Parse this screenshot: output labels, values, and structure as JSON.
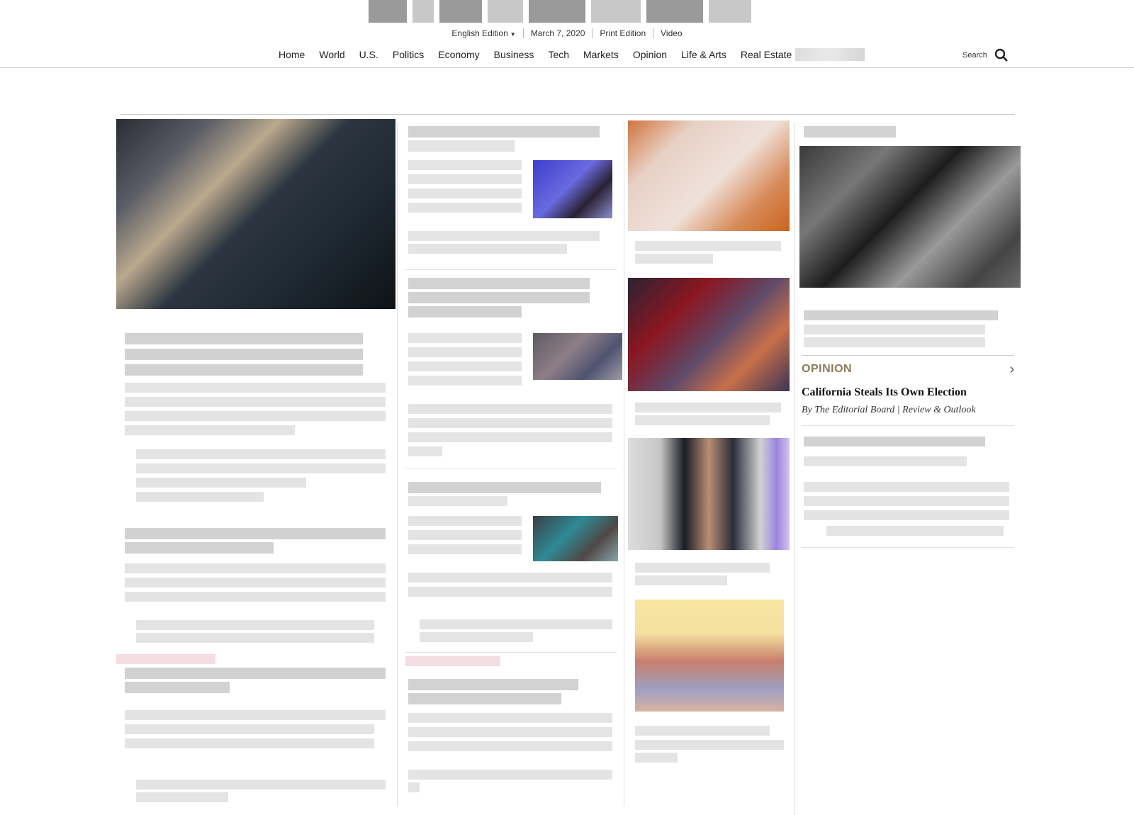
{
  "subbar": {
    "edition": "English Edition",
    "date": "March 7, 2020",
    "print": "Print Edition",
    "video": "Video"
  },
  "nav": {
    "items": [
      "Home",
      "World",
      "U.S.",
      "Politics",
      "Economy",
      "Business",
      "Tech",
      "Markets",
      "Opinion",
      "Life & Arts",
      "Real Estate"
    ],
    "search_label": "Search"
  },
  "opinion": {
    "label": "OPINION",
    "headline": "California Steals Its Own Election",
    "byline": "By The Editorial Board | Review & Outlook"
  }
}
